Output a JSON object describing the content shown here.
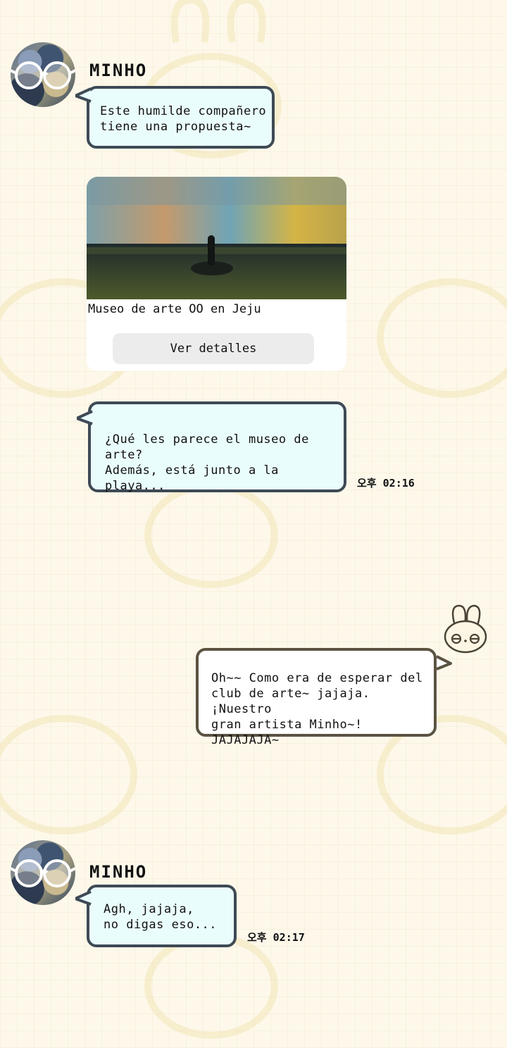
{
  "messages": [
    {
      "sender": "MINHO",
      "text": "Este humilde compañero\ntiene una propuesta~"
    },
    {
      "card": {
        "title": "Museo de arte OO en Jeju",
        "button_label": "Ver detalles"
      }
    },
    {
      "text": "¿Qué les parece el museo de arte?\nAdemás, está junto a la playa...",
      "time": "오후 02:16"
    },
    {
      "text": "Oh~~ Como era de esperar del\nclub de arte~ jajaja. ¡Nuestro\ngran artista Minho~! JAJAJAJA~",
      "own": true
    },
    {
      "sender": "MINHO",
      "text": "Agh, jajaja,\nno digas eso...",
      "time": "오후 02:17"
    }
  ],
  "colors": {
    "incoming_bubble": "#eafdfd",
    "incoming_border": "#3e4a55",
    "outgoing_bubble": "#ffffff",
    "outgoing_border": "#5b5342",
    "background": "#fdf8ea"
  },
  "icons": [
    "bunny-avatar-icon",
    "glasses-icon"
  ]
}
